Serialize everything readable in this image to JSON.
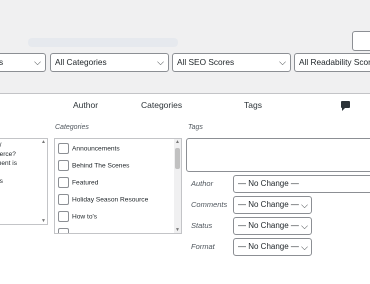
{
  "filters": {
    "first_tail": "s",
    "categories": "All Categories",
    "seo": "All SEO Scores",
    "readability": "All Readability Scor"
  },
  "header": {
    "author": "Author",
    "categories": "Categories",
    "tags": "Tags",
    "comments_icon": "comment-bubble-icon"
  },
  "left_fragments": [
    "?/",
    "nerce?",
    "ment is",
    "",
    "gs"
  ],
  "categories_section": {
    "label": "Categories",
    "items": [
      "Announcements",
      "Behind The Scenes",
      "Featured",
      "Holiday Season Resource",
      "How to's"
    ]
  },
  "tags_section": {
    "label": "Tags"
  },
  "fields": [
    {
      "label": "Author",
      "value": "— No Change —"
    },
    {
      "label": "Comments",
      "value": "— No Change —"
    },
    {
      "label": "Status",
      "value": "— No Change —"
    },
    {
      "label": "Format",
      "value": "— No Change —"
    }
  ]
}
